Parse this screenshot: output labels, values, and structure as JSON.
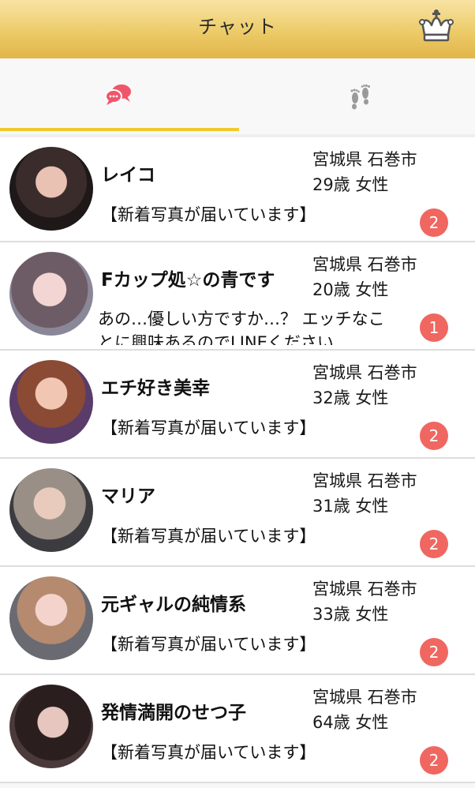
{
  "header": {
    "title": "チャット",
    "crown_icon": "crown-icon"
  },
  "tabs": [
    {
      "name": "chat",
      "icon": "chat-bubbles-icon",
      "active": true,
      "color": "#f0566a"
    },
    {
      "name": "footprints",
      "icon": "footprints-icon",
      "active": false,
      "color": "#9a9a9a"
    }
  ],
  "colors": {
    "header_top": "#f8e3a4",
    "header_bottom": "#e2b54a",
    "active_tab_underline": "#f2c82d",
    "badge": "#ef6760"
  },
  "chats": [
    {
      "name": "レイコ",
      "location": "宮城県 石巻市",
      "age_gender": "29歳 女性",
      "message": "【新着写真が届いています】",
      "unread": "2"
    },
    {
      "name": "Fカップ処☆の青です",
      "location": "宮城県 石巻市",
      "age_gender": "20歳 女性",
      "message": "あの…優しい方ですか…？ エッチなことに興味あるのでLINEください",
      "unread": "1"
    },
    {
      "name": "エチ好き美幸",
      "location": "宮城県 石巻市",
      "age_gender": "32歳 女性",
      "message": "【新着写真が届いています】",
      "unread": "2"
    },
    {
      "name": "マリア",
      "location": "宮城県 石巻市",
      "age_gender": "31歳 女性",
      "message": "【新着写真が届いています】",
      "unread": "2"
    },
    {
      "name": "元ギャルの純情系",
      "location": "宮城県 石巻市",
      "age_gender": "33歳 女性",
      "message": "【新着写真が届いています】",
      "unread": "2"
    },
    {
      "name": "発情満開のせつ子",
      "location": "宮城県 石巻市",
      "age_gender": "64歳 女性",
      "message": "【新着写真が届いています】",
      "unread": "2"
    }
  ]
}
